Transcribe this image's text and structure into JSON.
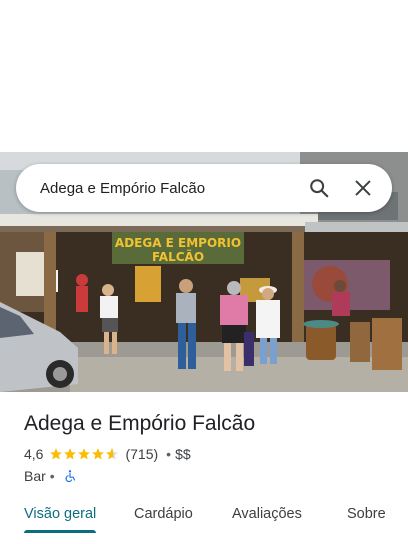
{
  "search": {
    "query": "Adega e Empório Falcão"
  },
  "icons": {
    "search": "search-icon",
    "close": "close-icon",
    "star": "star-icon",
    "accessibility": "wheelchair-icon"
  },
  "photo": {
    "sign_text_line1": "ADEGA E EMPORIO",
    "sign_text_line2": "FALCÃO"
  },
  "place": {
    "name": "Adega e Empório Falcão",
    "rating": "4,6",
    "stars": 4.6,
    "review_count": "(715)",
    "separator": "•",
    "price": "$$",
    "category": "Bar"
  },
  "tabs": [
    {
      "label": "Visão geral",
      "active": true
    },
    {
      "label": "Cardápio",
      "active": false
    },
    {
      "label": "Avaliações",
      "active": false
    },
    {
      "label": "Sobre",
      "active": false
    }
  ],
  "colors": {
    "accent": "#0b6e80",
    "star": "#fbbc04",
    "accessibility_icon": "#1a73e8",
    "sign_yellow": "#f2c230"
  }
}
